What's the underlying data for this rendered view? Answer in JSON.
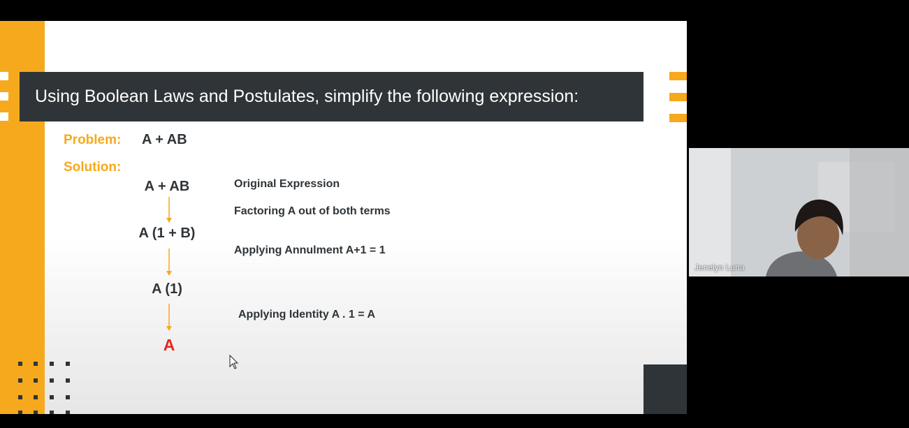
{
  "slide": {
    "title": "Using Boolean Laws and Postulates, simplify the following expression:",
    "problem_label": "Problem:",
    "problem_expression": "A + AB",
    "solution_label": "Solution:",
    "steps": [
      {
        "expression": "A + AB",
        "note": "Original Expression"
      },
      {
        "expression": "A (1 + B)",
        "note": "Factoring A out of both terms"
      },
      {
        "expression": "A (1)",
        "note": "Applying Annulment A+1 = 1"
      },
      {
        "expression": "A",
        "note": "Applying Identity A . 1 = A"
      }
    ],
    "accent_color": "#f6a91c",
    "dark_color": "#2f3438",
    "result_color": "#e5261e"
  },
  "video": {
    "participant_name": "Jenelyn Luna"
  },
  "icons": [
    "cursor-icon",
    "arrow-down-icon"
  ]
}
